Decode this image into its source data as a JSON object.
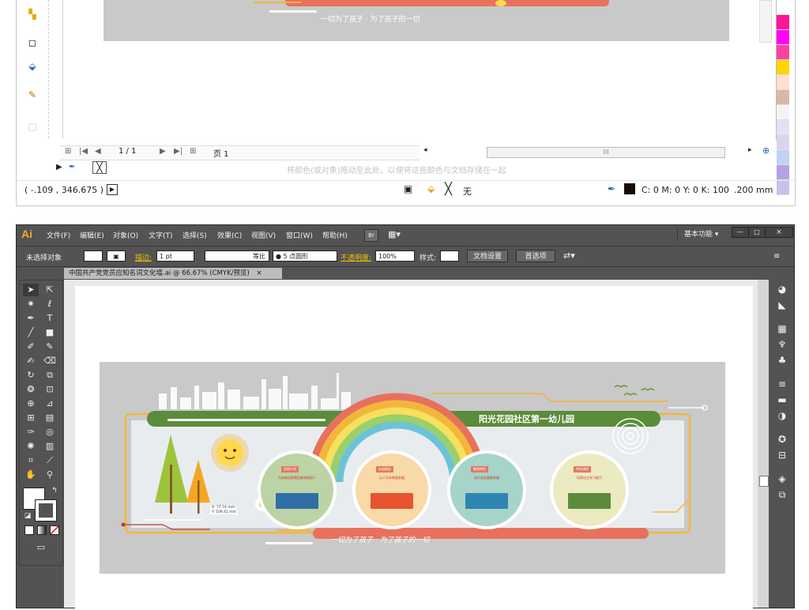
{
  "top_window": {
    "page_counter": "1 / 1",
    "page_tab": "页 1",
    "hscroll_grip": "III",
    "hint_text": "将颜色(或对象)拖动至此处，以便将这些颜色与文档存储在一起",
    "cursor_position": "( -.109 , 346.675 )",
    "fill_none_label": "无",
    "color_readout": "C: 0 M: 0 Y: 0 K: 100",
    "stroke_width": ".200 mm",
    "palette_colors": [
      "#ffffff",
      "#ff1493",
      "#ff00ff",
      "#ff3fa0",
      "#ffd400",
      "#ffe0cc",
      "#d9b8a6",
      "#f4f4f4",
      "#e6e0f0",
      "#dcd4ee",
      "#bcd4f2",
      "#b6a0e6",
      "#c8c0e8"
    ]
  },
  "artboard_slogan": "一切为了孩子 · 为了孩子的一切",
  "ai_window": {
    "logo": "Ai",
    "menus": [
      "文件(F)",
      "编辑(E)",
      "对象(O)",
      "文字(T)",
      "选择(S)",
      "效果(C)",
      "视图(V)",
      "窗口(W)",
      "帮助(H)"
    ],
    "bridge_label": "Br",
    "workspace": "基本功能",
    "window_buttons": [
      "—",
      "□",
      "×"
    ],
    "control": {
      "selection_status": "未选择对象",
      "stroke_label": "描边:",
      "stroke_weight": "1 pt",
      "line_style": "等比",
      "brush": "5 点圆形",
      "opacity_label": "不透明度:",
      "opacity_value": "100%",
      "style_label": "样式:",
      "doc_setup": "文档设置",
      "preferences": "首选项"
    },
    "document_tab": "中国共产党党员应知名词文化墙.ai @ 66.67% (CMYK/预览)",
    "document_tab_close": "×"
  },
  "artwork": {
    "banner_title": "阳光花园社区第一幼儿园",
    "slogan": "一切为了孩子 · 为了孩子的一切",
    "measure_x": "X: 77.74 mm",
    "measure_y": "Y: 109.41 mm",
    "circles": [
      {
        "label": "学校介绍",
        "text": "为未来培养建设者和接班人",
        "fill": "#bcd3a5",
        "label_color": "#e07a5f",
        "box_color": "#2f6fa6"
      },
      {
        "label": "办园理念",
        "text": "以人为本和谐发展",
        "fill": "#f8d9a8",
        "label_color": "#e07a5f",
        "box_color": "#e8542e"
      },
      {
        "label": "教育特色",
        "text": "快乐成长健康发展",
        "fill": "#a7d4c8",
        "label_color": "#e07a5f",
        "box_color": "#2e86b0"
      },
      {
        "label": "特色课程",
        "text": "培养自主学习能力",
        "fill": "#eceac0",
        "label_color": "#e07a5f",
        "box_color": "#5a8c3a"
      }
    ],
    "colors": {
      "banner_green": "#5a8c3a",
      "arc_orange": "#f4b63a",
      "bottom_bar": "#e8715e",
      "panel_bg": "#e9ecef"
    }
  }
}
